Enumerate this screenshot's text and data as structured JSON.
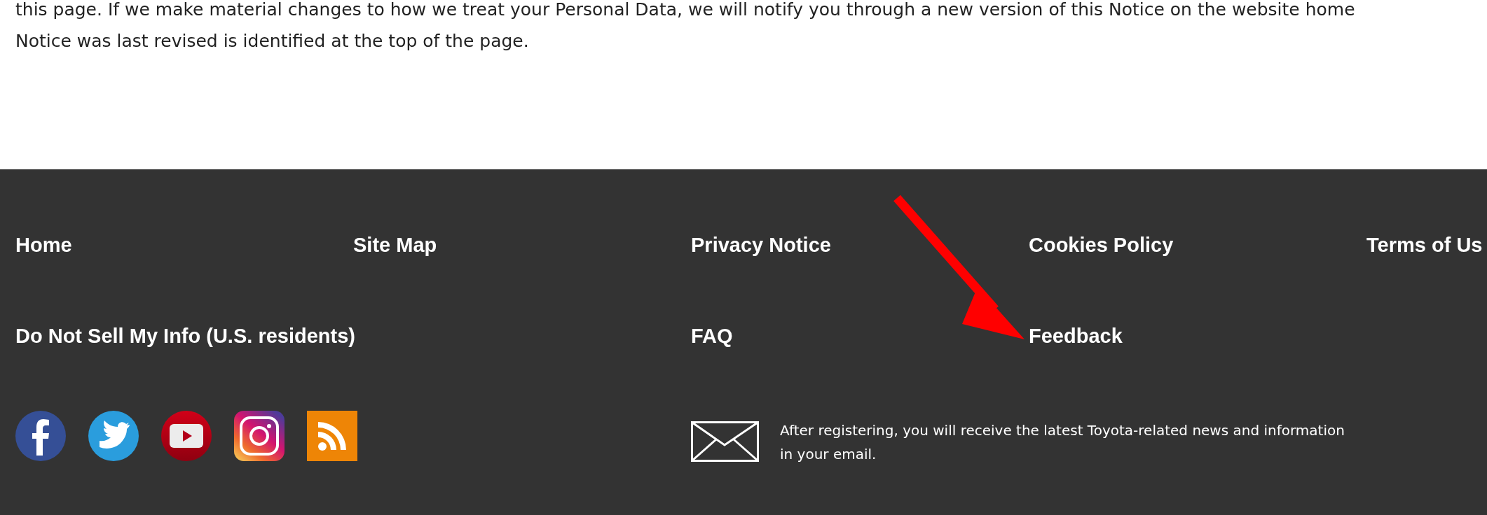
{
  "notice_text": {
    "lines": [
      "this page. If we make material changes to how we treat your Personal Data, we will notify you through a new version of this Notice on the website home",
      "Notice was last revised is identified at the top of the page."
    ]
  },
  "footer": {
    "links": [
      {
        "label": "Home"
      },
      {
        "label": "Site Map"
      },
      {
        "label": "Privacy Notice"
      },
      {
        "label": "Cookies Policy"
      },
      {
        "label": "Terms of Us"
      },
      {
        "label": "Do Not Sell My Info (U.S. residents)"
      },
      {
        "label": "FAQ"
      },
      {
        "label": "Feedback"
      }
    ],
    "social": [
      {
        "kind": "facebook"
      },
      {
        "kind": "twitter"
      },
      {
        "kind": "youtube"
      },
      {
        "kind": "instagram"
      },
      {
        "kind": "rss"
      }
    ],
    "email_text": "After registering, you will receive the latest Toyota-related news and information in your email."
  }
}
